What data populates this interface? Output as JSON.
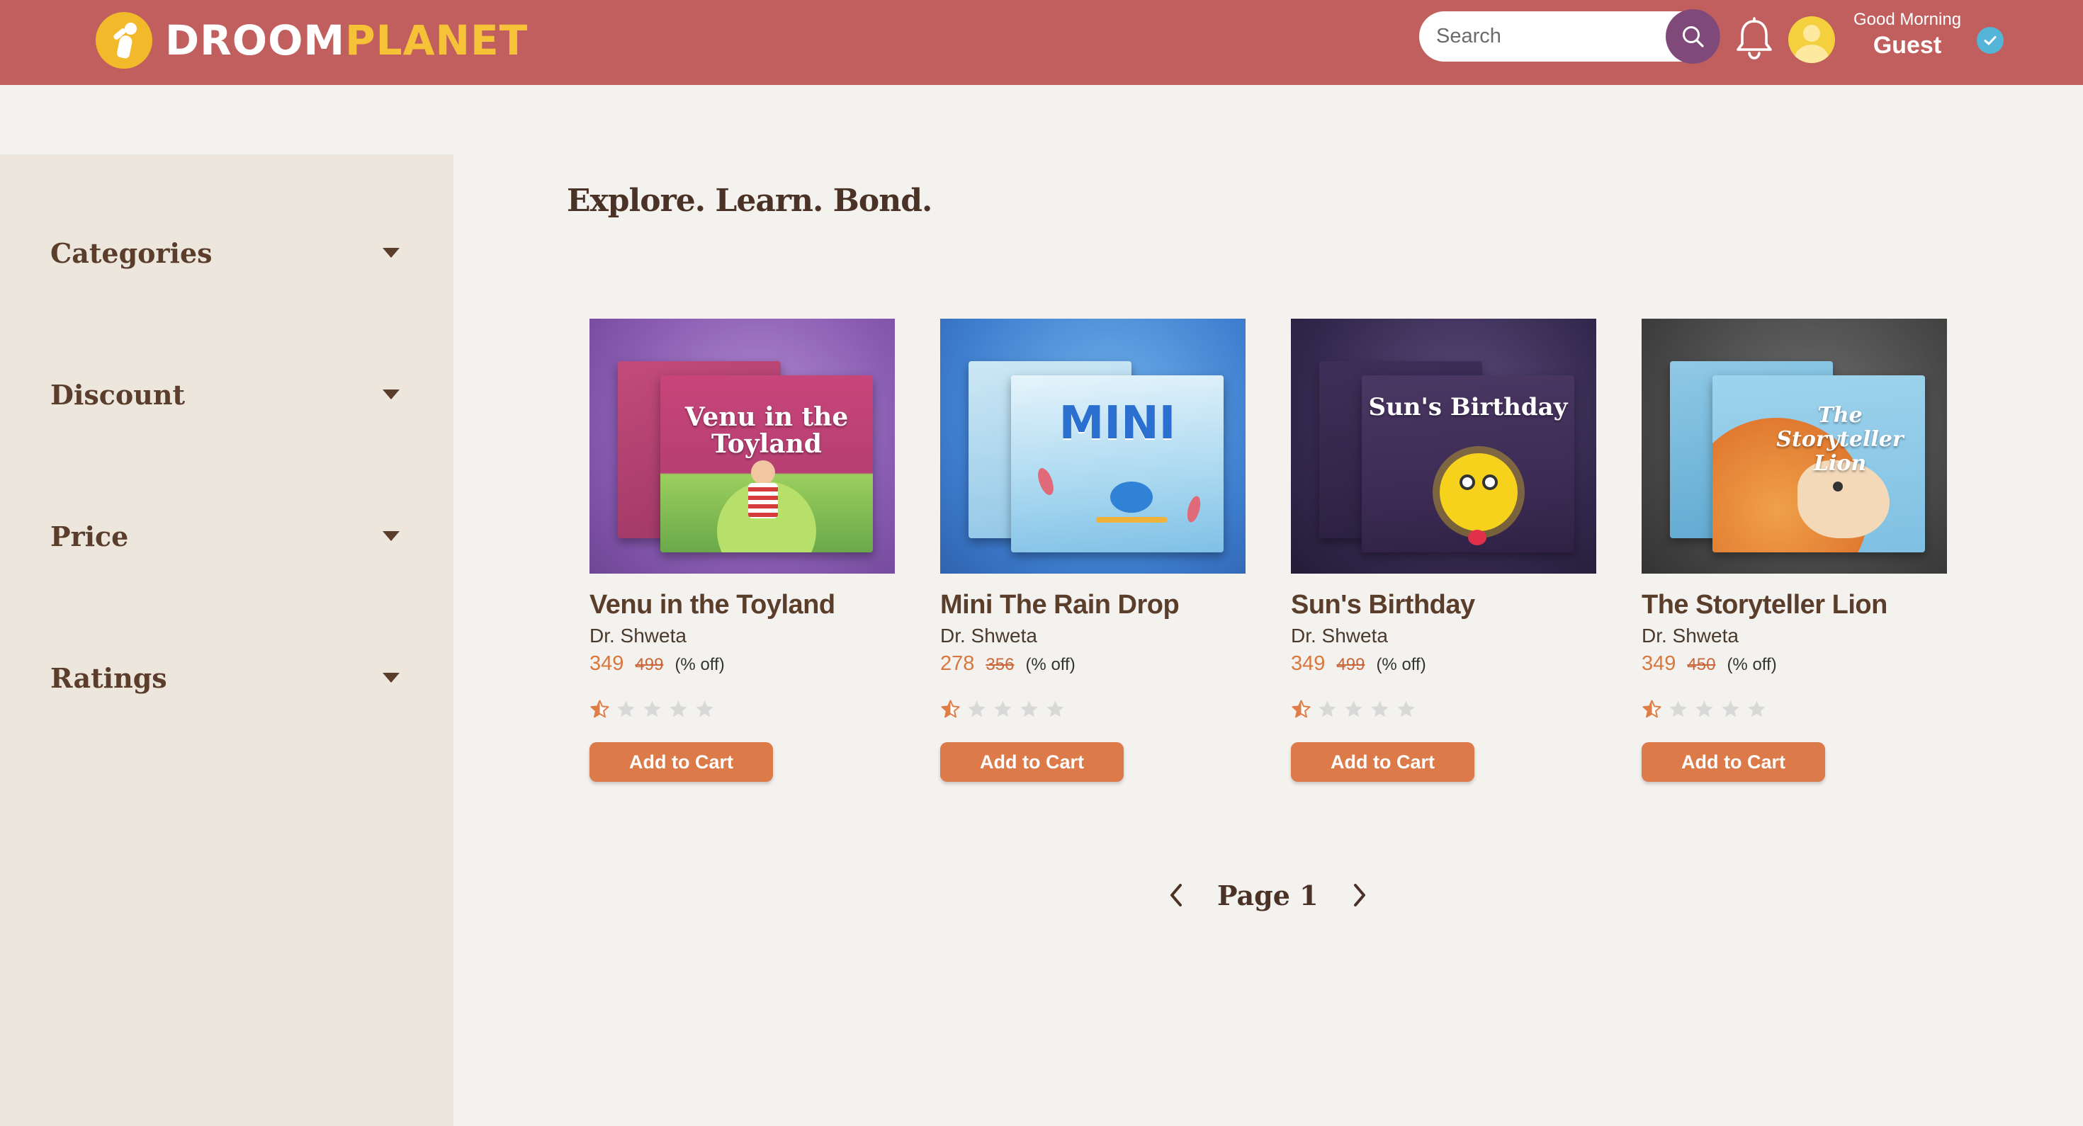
{
  "brand": {
    "name_part1": "DROOM",
    "name_part2": "PLANET",
    "logo_icon": "kid-logo-icon"
  },
  "header": {
    "search_placeholder": "Search",
    "search_icon": "search-icon",
    "notifications_icon": "bell-icon",
    "greeting": "Good Morning",
    "user_name": "Guest",
    "verified_icon": "check-badge-icon"
  },
  "colors": {
    "header_bg": "#c15f5e",
    "accent_orange": "#dc7a49",
    "brand_yellow": "#f6c238",
    "search_button": "#7f4a7a",
    "text_brown": "#5a3e2b",
    "sidebar_bg": "#ece6dd",
    "page_bg": "#f4f2ee"
  },
  "filters": [
    {
      "label": "Categories"
    },
    {
      "label": "Discount"
    },
    {
      "label": "Price"
    },
    {
      "label": "Ratings"
    }
  ],
  "page_title": "Explore. Learn. Bond.",
  "products": [
    {
      "title": "Venu in the Toyland",
      "author": "Dr. Shweta",
      "price": "349",
      "mrp": "499",
      "discount": "(% off)",
      "rating": 0.5,
      "cover_text": "Venu in the Toyland",
      "button": "Add to Cart"
    },
    {
      "title": "Mini The Rain Drop",
      "author": "Dr. Shweta",
      "price": "278",
      "mrp": "356",
      "discount": "(% off)",
      "rating": 0.5,
      "cover_text": "MINI",
      "button": "Add to Cart"
    },
    {
      "title": "Sun's Birthday",
      "author": "Dr. Shweta",
      "price": "349",
      "mrp": "499",
      "discount": "(% off)",
      "rating": 0.5,
      "cover_text": "Sun's Birthday",
      "button": "Add to Cart"
    },
    {
      "title": "The Storyteller Lion",
      "author": "Dr. Shweta",
      "price": "349",
      "mrp": "450",
      "discount": "(% off)",
      "rating": 0.5,
      "cover_text": "The Storyteller Lion",
      "button": "Add to Cart"
    }
  ],
  "pagination": {
    "label": "Page 1",
    "prev_icon": "chevron-left-icon",
    "next_icon": "chevron-right-icon"
  }
}
